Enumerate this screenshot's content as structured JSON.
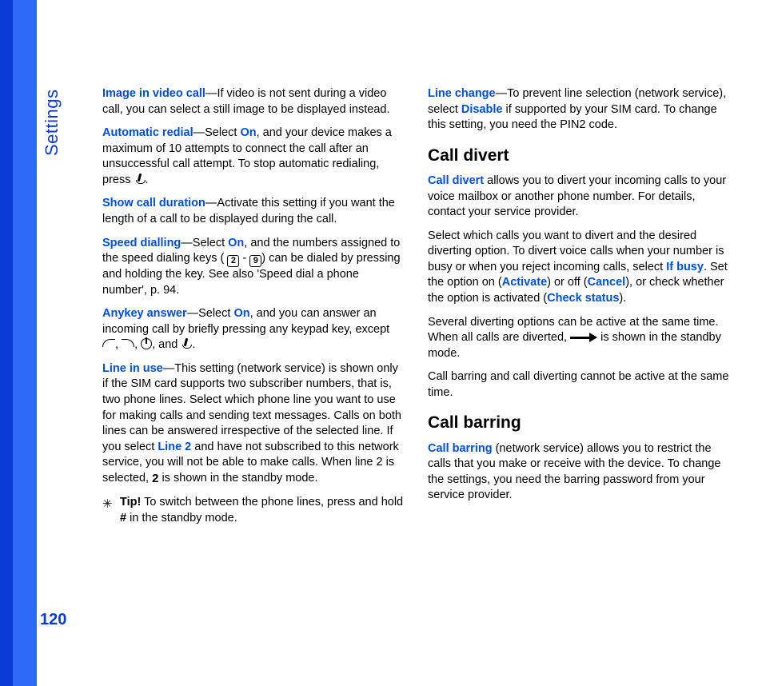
{
  "sidebar": {
    "label": "Settings"
  },
  "page_number": "120",
  "left": {
    "p1": {
      "term": "Image in video call",
      "text": "—If video is not sent during a video call, you can select a still image to be displayed instead."
    },
    "p2": {
      "term": "Automatic redial",
      "pre": "—Select ",
      "opt": "On",
      "post": ", and your device makes a maximum of 10 attempts to connect the call after an unsuccessful call attempt. To stop automatic redialing, press ",
      "tail": "."
    },
    "p3": {
      "term": "Show call duration",
      "text": "—Activate this setting if you want the length of a call to be displayed during the call."
    },
    "p4": {
      "term": "Speed dialling",
      "pre": "—Select ",
      "opt": "On",
      "mid1": ", and the numbers assigned to the speed dialing keys (",
      "icon2": "2",
      "dash": " - ",
      "icon9": "9",
      "mid2": ") can be dialed by pressing and holding the key. See also 'Speed dial a phone number', p. 94."
    },
    "p5": {
      "term": "Anykey answer",
      "pre": "—Select ",
      "opt": "On",
      "mid": ", and you can answer an incoming call by briefly pressing any keypad key, except ",
      "sep1": ", ",
      "sep2": ", ",
      "sep3": ", and ",
      "tail": "."
    },
    "p6": {
      "term": "Line in use",
      "pre": "—This setting (network service) is shown only if the SIM card supports two subscriber numbers, that is, two phone lines. Select which phone line you want to use for making calls and sending text messages. Calls on both lines can be answered irrespective of the selected line. If you select ",
      "opt": "Line 2",
      "mid": " and have not subscribed to this network service, you will not be able to make calls. When line 2 is selected, ",
      "icon": "2",
      "tail": " is shown in the standby mode."
    },
    "tip": {
      "label": "Tip!",
      "pre": " To switch between the phone lines, press and hold ",
      "hash": "#",
      "post": " in the standby mode."
    }
  },
  "right": {
    "p1": {
      "term": "Line change",
      "pre": "—To prevent line selection (network service), select ",
      "opt": "Disable",
      "post": " if supported by your SIM card. To change this setting, you need the PIN2 code."
    },
    "h1": "Call divert",
    "p2": {
      "term": "Call divert",
      "text": " allows you to divert your incoming calls to your voice mailbox or another phone number. For details, contact your service provider."
    },
    "p3": {
      "pre": "Select which calls you want to divert and the desired diverting option. To divert voice calls when your number is busy or when you reject incoming calls, select ",
      "opt1": "If busy",
      "mid1": ". Set the option on (",
      "opt2": "Activate",
      "mid2": ") or off (",
      "opt3": "Cancel",
      "mid3": "), or check whether the option is activated (",
      "opt4": "Check status",
      "tail": ")."
    },
    "p4": {
      "pre": "Several diverting options can be active at the same time. When all calls are diverted, ",
      "post": " is shown in the standby mode."
    },
    "p5": "Call barring and call diverting cannot be active at the same time.",
    "h2": "Call barring",
    "p6": {
      "term": "Call barring",
      "text": " (network service) allows you to restrict the calls that you make or receive with the device. To change the settings, you need the barring password from your service provider."
    }
  }
}
